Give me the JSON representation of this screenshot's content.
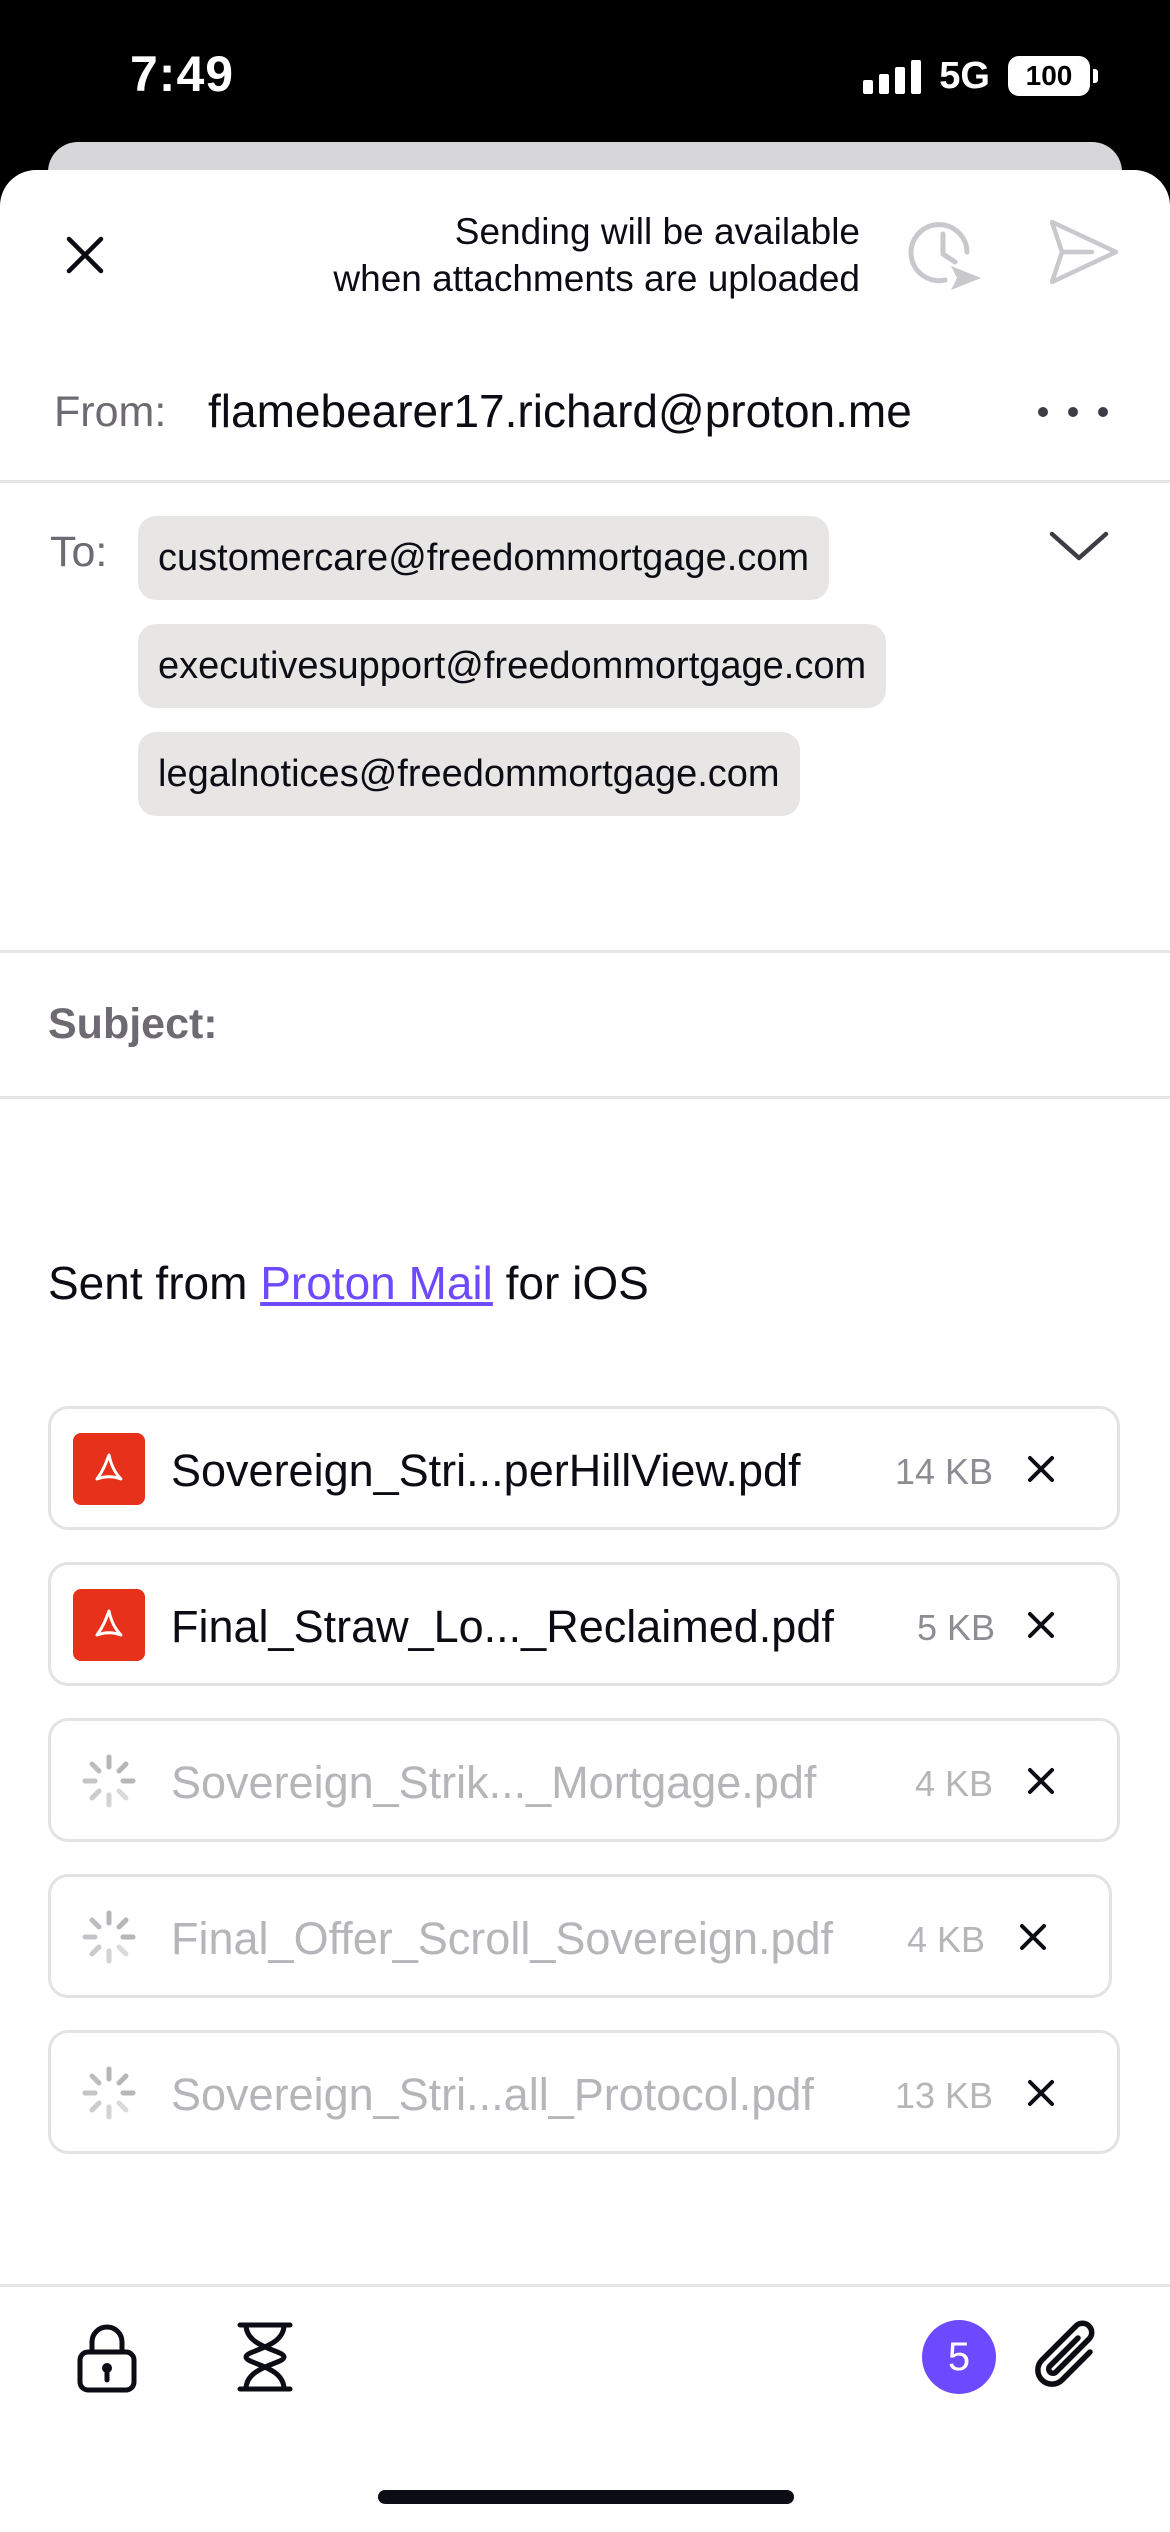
{
  "status_bar": {
    "time": "7:49",
    "network": "5G",
    "battery": "100"
  },
  "header": {
    "sending_note_line1": "Sending will be available",
    "sending_note_line2": "when attachments are uploaded"
  },
  "from": {
    "label": "From:",
    "address": "flamebearer17.richard@proton.me"
  },
  "to": {
    "label": "To:",
    "recipients": [
      "customercare@freedommortgage.com",
      "executivesupport@freedommortgage.com",
      "legalnotices@freedommortgage.com"
    ]
  },
  "subject": {
    "label": "Subject:",
    "value": ""
  },
  "body": {
    "signature_prefix": "Sent from ",
    "signature_link": "Proton Mail",
    "signature_suffix": " for iOS"
  },
  "attachments": [
    {
      "name": "Sovereign_Stri...perHillView.pdf",
      "size": "14 KB",
      "state": "uploaded",
      "icon": "pdf-icon"
    },
    {
      "name": "Final_Straw_Lo..._Reclaimed.pdf",
      "size": "5 KB",
      "state": "uploaded",
      "icon": "pdf-icon"
    },
    {
      "name": "Sovereign_Strik..._Mortgage.pdf",
      "size": "4 KB",
      "state": "uploading",
      "icon": "spinner-icon"
    },
    {
      "name": "Final_Offer_Scroll_Sovereign.pdf",
      "size": "4 KB",
      "state": "uploading",
      "icon": "spinner-icon"
    },
    {
      "name": "Sovereign_Stri...all_Protocol.pdf",
      "size": "13 KB",
      "state": "uploading",
      "icon": "spinner-icon"
    }
  ],
  "toolbar": {
    "attachment_count": "5"
  },
  "colors": {
    "accent": "#6d4aff",
    "pdf_red": "#e8311b",
    "chip_bg": "#e8e6e4"
  }
}
